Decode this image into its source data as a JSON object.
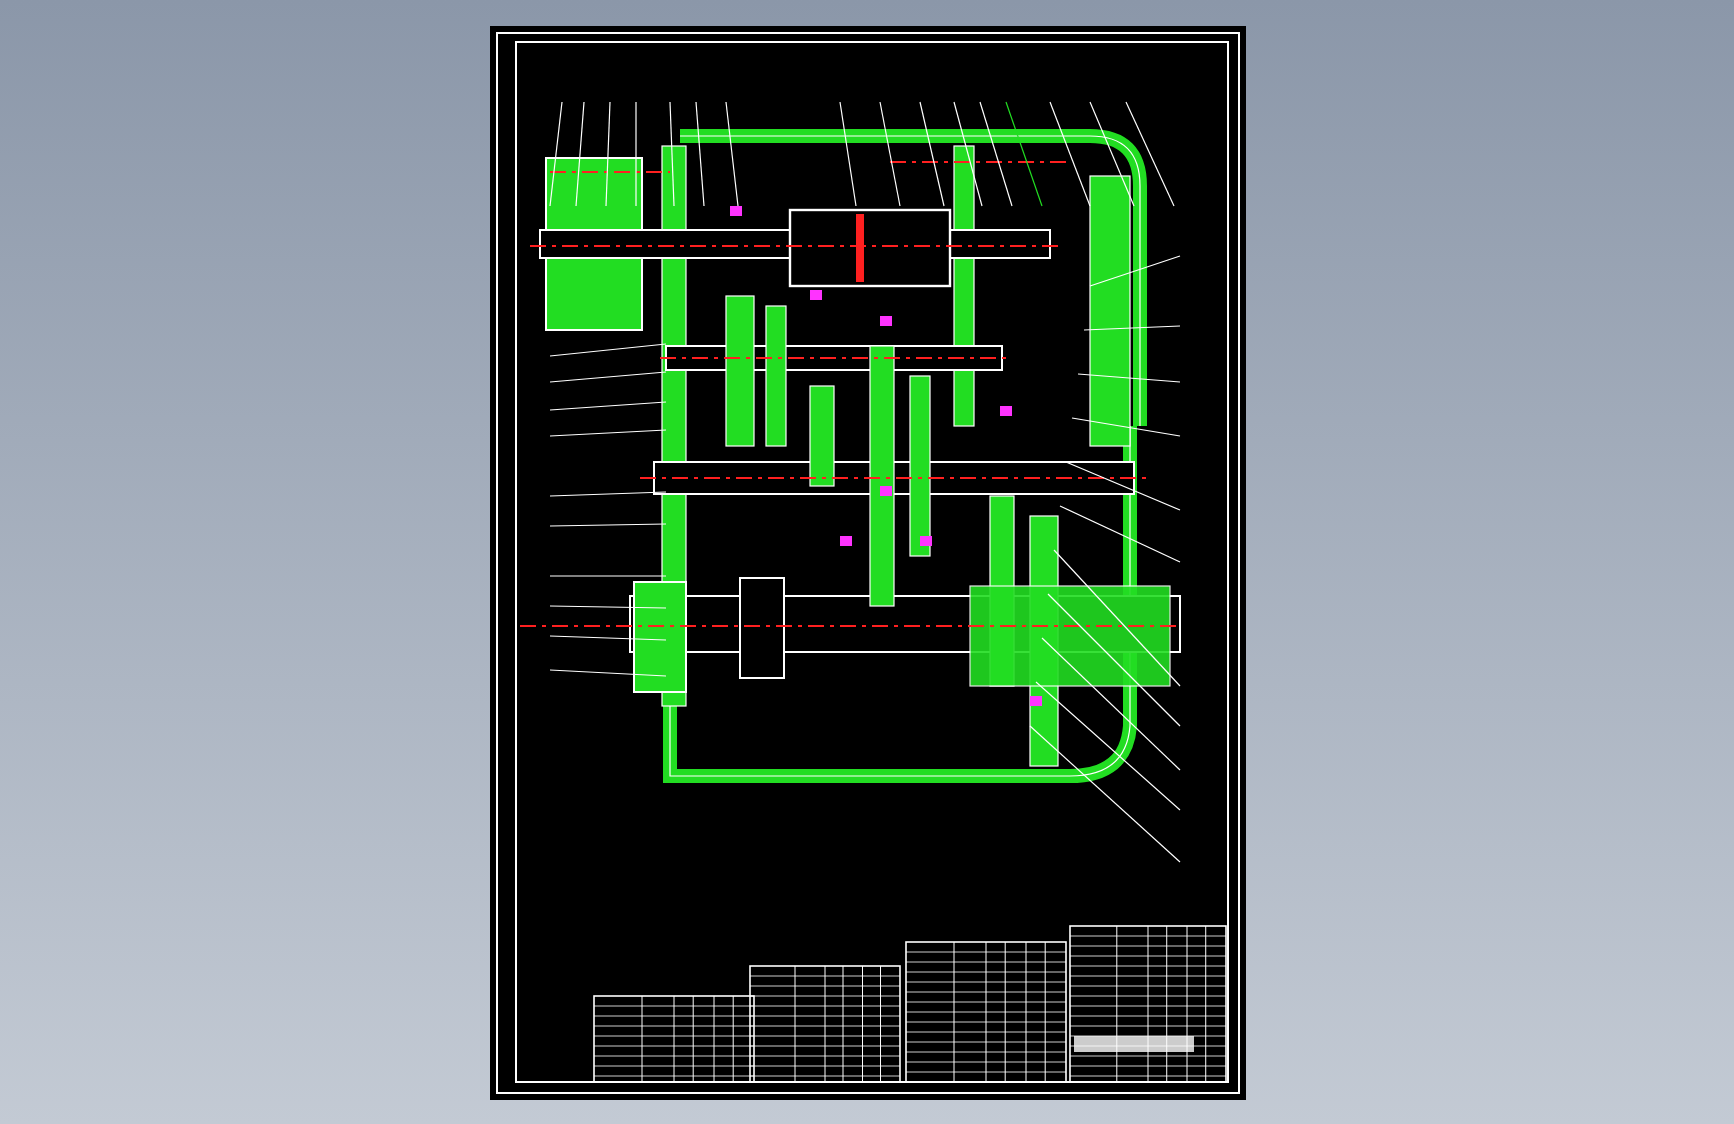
{
  "drawing": {
    "kind": "gearbox-section",
    "title_block": true
  }
}
